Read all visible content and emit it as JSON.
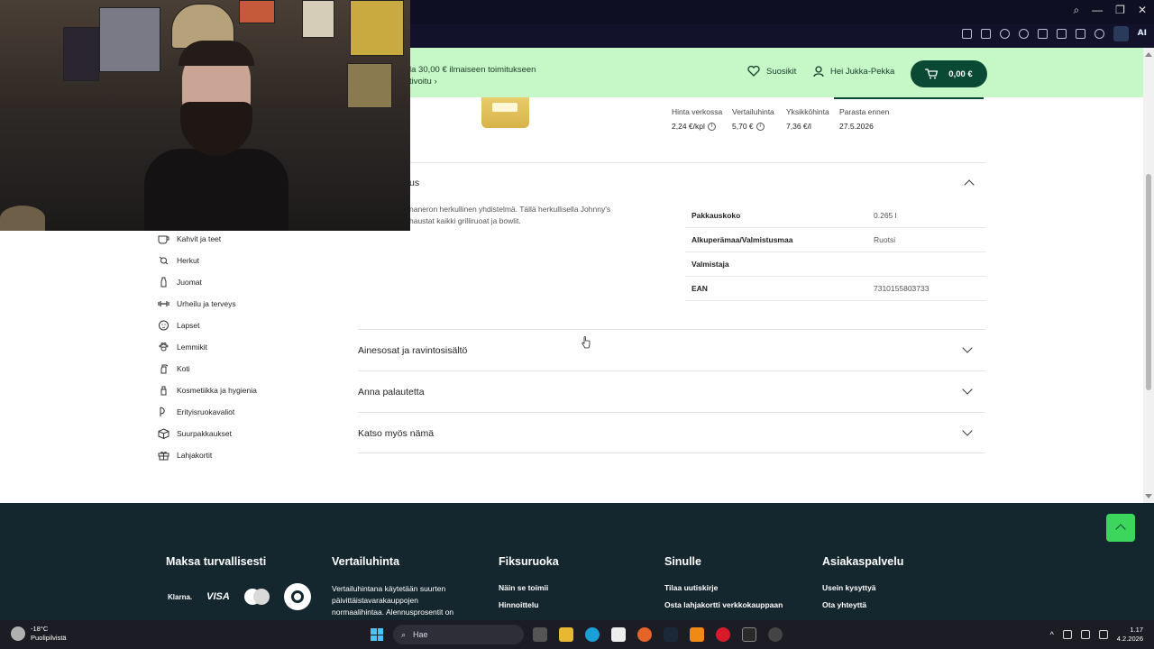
{
  "header": {
    "promo_line1": "la 30,00 € ilmaiseen toimitukseen",
    "promo_line2": "tivoitu ›",
    "favorites": "Suosikit",
    "greeting": "Hei Jukka-Pekka",
    "cart_total": "0,00 €"
  },
  "prices": [
    {
      "label": "Hinta verkossa",
      "value": "2,24 €/kpl"
    },
    {
      "label": "Vertailuhinta",
      "value": "5,70 €"
    },
    {
      "label": "Yksikköhinta",
      "value": "7,36 €/l"
    },
    {
      "label": "Parasta ennen",
      "value": "27.5.2026"
    }
  ],
  "description": {
    "title": "us",
    "text_line1": "naneron herkullinen yhdistelmä. Tällä herkullisella Johnny's",
    "text_line2": "haustat kaikki grilliruoat ja bowlit."
  },
  "specs": [
    {
      "key": "Pakkauskoko",
      "value": "0.265 l"
    },
    {
      "key": "Alkuperämaa/Valmistusmaa",
      "value": "Ruotsi"
    },
    {
      "key": "Valmistaja",
      "value": ""
    },
    {
      "key": "EAN",
      "value": "7310155803733"
    }
  ],
  "categories": [
    {
      "label": "Kahvit ja teet",
      "icon": "coffee-icon"
    },
    {
      "label": "Herkut",
      "icon": "candy-icon"
    },
    {
      "label": "Juomat",
      "icon": "bottle-icon"
    },
    {
      "label": "Urheilu ja terveys",
      "icon": "dumbbell-icon"
    },
    {
      "label": "Lapset",
      "icon": "baby-icon"
    },
    {
      "label": "Lemmikit",
      "icon": "paw-icon"
    },
    {
      "label": "Koti",
      "icon": "spray-icon"
    },
    {
      "label": "Kosmetiikka ja hygienia",
      "icon": "cosmetics-icon"
    },
    {
      "label": "Erityisruokavaliot",
      "icon": "diet-icon"
    },
    {
      "label": "Suurpakkaukset",
      "icon": "box-icon"
    },
    {
      "label": "Lahjakortit",
      "icon": "gift-icon"
    }
  ],
  "accordions": [
    {
      "label": "Ainesosat ja ravintosisältö"
    },
    {
      "label": "Anna palautetta"
    },
    {
      "label": "Katso myös nämä"
    }
  ],
  "footer": {
    "pay_title": "Maksa turvallisesti",
    "pay_klarna": "Klarna.",
    "pay_visa": "VISA",
    "compare_title": "Vertailuhinta",
    "compare_text": "Vertailuhintana käytetään suurten päivittäistavarakauppojen normaalihintaa. Alennusprosentit on",
    "fiksu_title": "Fiksuruoka",
    "fiksu_links": [
      "Näin se toimii",
      "Hinnoittelu"
    ],
    "sinulle_title": "Sinulle",
    "sinulle_links": [
      "Tilaa uutiskirje",
      "Osta lahjakortti verkkokauppaan"
    ],
    "asiakas_title": "Asiakaspalvelu",
    "asiakas_links": [
      "Usein kysyttyä",
      "Ota yhteyttä"
    ]
  },
  "taskbar": {
    "temp": "-18°C",
    "weather": "Puolipilvistä",
    "search": "Hae",
    "time": "1.17",
    "date": "4.2.2026"
  },
  "toolbar": {
    "ai_label": "AI"
  },
  "colors": {
    "header_bg": "#c6f7c6",
    "brand_dark": "#0a4a34",
    "footer_bg": "#14262e",
    "scroll_top": "#3cd65c"
  }
}
